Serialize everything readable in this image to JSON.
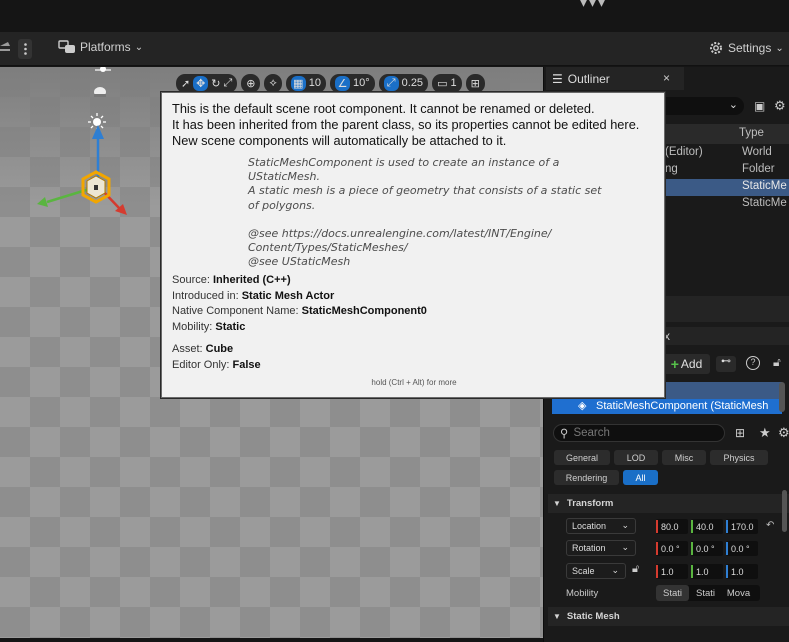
{
  "toolbar": {
    "platforms_label": "Platforms",
    "settings_label": "Settings"
  },
  "viewport_toolbar": {
    "grid_snap": "10",
    "rotation_snap": "10°",
    "scale_snap": "0.25",
    "camera_speed": "1"
  },
  "outliner": {
    "tab_label": "Outliner",
    "close_glyph": "×",
    "type_header": "Type",
    "rows": [
      {
        "name": "(Editor)",
        "type": "World"
      },
      {
        "name": "ng",
        "type": "Folder"
      },
      {
        "name": "",
        "type": "StaticMe"
      },
      {
        "name": "",
        "type": "StaticMe"
      }
    ]
  },
  "details": {
    "tab_fragment": "x",
    "add_label": "Add",
    "selected_component": "StaticMeshComponent (StaticMesh",
    "search_placeholder": "Search",
    "filters_row1": [
      "General",
      "LOD",
      "Misc",
      "Physics"
    ],
    "filters_row2": [
      "Rendering",
      "All"
    ],
    "transform_label": "Transform",
    "location_label": "Location",
    "rotation_label": "Rotation",
    "scale_label": "Scale",
    "location_values": [
      "80.0",
      "40.0",
      "170.0"
    ],
    "rotation_values": [
      "0.0 °",
      "0.0 °",
      "0.0 °"
    ],
    "scale_values": [
      "1.0",
      "1.0",
      "1.0"
    ],
    "mobility_label": "Mobility",
    "mobility_options": [
      "Stati",
      "Stati",
      "Mova"
    ],
    "static_mesh_label": "Static Mesh"
  },
  "tooltip": {
    "line1": "This is the default scene root component. It cannot be renamed or deleted.",
    "line2": "It has been inherited from the parent class, so its properties cannot be edited here.",
    "line3": "New scene components will automatically be attached to it.",
    "doc": "StaticMeshComponent is used to create an instance of a\nUStaticMesh.\nA static mesh is a piece of geometry that consists of a static set\nof polygons.\n\n@see https://docs.unrealengine.com/latest/INT/Engine/\nContent/Types/StaticMeshes/\n@see UStaticMesh",
    "source_label": "Source:",
    "source_value": "Inherited (C++)",
    "introduced_label": "Introduced in:",
    "introduced_value": "Static Mesh Actor",
    "native_label": "Native Component Name:",
    "native_value": "StaticMeshComponent0",
    "mobility_label": "Mobility:",
    "mobility_value": "Static",
    "asset_label": "Asset:",
    "asset_value": "Cube",
    "editor_only_label": "Editor Only:",
    "editor_only_value": "False",
    "footer": "hold (Ctrl + Alt) for more"
  },
  "colors": {
    "accent": "#1a6fc7",
    "selection": "#3b5a86",
    "axis_x": "#d53b2f",
    "axis_y": "#5ab540",
    "axis_z": "#2f7fd3"
  }
}
